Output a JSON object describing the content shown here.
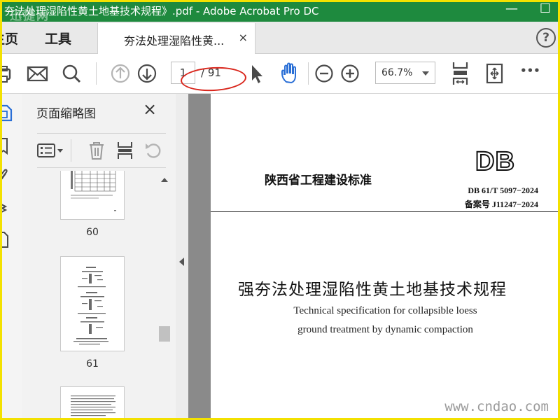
{
  "window": {
    "title": "夯法处理湿陷性黄土地基技术规程》.pdf - Adobe Acrobat Pro DC",
    "watermark_logo": "迅捷网",
    "buttons": {
      "minimize": "—",
      "maximize": "☐"
    }
  },
  "tabs": {
    "home_label": "主页",
    "tools_label": "工具",
    "document_tab_label": "夯法处理湿陷性黄...",
    "document_tab_close": "×",
    "help_label": "?"
  },
  "toolbar": {
    "current_page": "1",
    "total_pages": "/ 91",
    "zoom_value": "66.7%",
    "more_label": "•••"
  },
  "thumbnail_panel": {
    "title": "页面缩略图",
    "close_label": "×",
    "thumbnails": [
      {
        "page_label": "60"
      },
      {
        "page_label": "61"
      }
    ]
  },
  "document_page": {
    "organization": "陕西省工程建设标准",
    "db_mark": "DB",
    "standard_number": "DB  61/T  5097−2024",
    "record_number": "备案号   J11247−2024",
    "title_cn": "强夯法处理湿陷性黄土地基技术规程",
    "title_en_line1": "Technical specification for collapsible loess",
    "title_en_line2": "ground treatment by dynamic compaction",
    "watermark": "www.cndao.com"
  },
  "colors": {
    "titlebar": "#1e8a3e",
    "frame_border": "#f3e100",
    "annotation_oval": "#d9261c",
    "hand_tool": "#2a6fd6"
  }
}
